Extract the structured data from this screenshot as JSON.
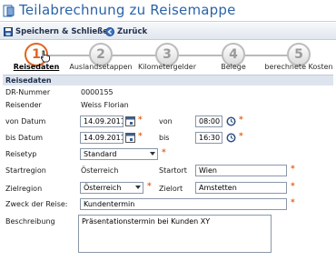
{
  "window": {
    "title": "Teilabrechnung zu Reisemappe"
  },
  "toolbar": {
    "save_label": "Speichern & Schließen",
    "back_label": "Zurück"
  },
  "steps": [
    {
      "number": "1",
      "label": "Reisedaten",
      "active": true
    },
    {
      "number": "2",
      "label": "Auslandsetappen",
      "active": false
    },
    {
      "number": "3",
      "label": "Kilometergelder",
      "active": false
    },
    {
      "number": "4",
      "label": "Belege",
      "active": false
    },
    {
      "number": "5",
      "label": "berechnete Kosten",
      "active": false
    }
  ],
  "section": {
    "title": "Reisedaten"
  },
  "form": {
    "dr_nummer": {
      "label": "DR-Nummer",
      "value": "0000155"
    },
    "reisender": {
      "label": "Reisender",
      "value": "Weiss Florian"
    },
    "von_datum": {
      "label": "von Datum",
      "value": "14.09.2011"
    },
    "von_zeit": {
      "label": "von",
      "value": "08:00"
    },
    "bis_datum": {
      "label": "bis Datum",
      "value": "14.09.2011"
    },
    "bis_zeit": {
      "label": "bis",
      "value": "16:30"
    },
    "reisetyp": {
      "label": "Reisetyp",
      "value": "Standard"
    },
    "startregion": {
      "label": "Startregion",
      "value": "Österreich"
    },
    "startort": {
      "label": "Startort",
      "value": "Wien"
    },
    "zielregion": {
      "label": "Zielregion",
      "value": "Österreich"
    },
    "zielort": {
      "label": "Zielort",
      "value": "Amstetten"
    },
    "zweck": {
      "label": "Zweck der Reise:",
      "value": "Kundentermin"
    },
    "beschreibung": {
      "label": "Beschreibung",
      "value": "Präsentationstermin bei Kunden XY"
    },
    "required_marker": "*"
  },
  "colors": {
    "accent": "#e0641e",
    "title": "#2b63a7",
    "section_bg": "#dde4ee"
  }
}
